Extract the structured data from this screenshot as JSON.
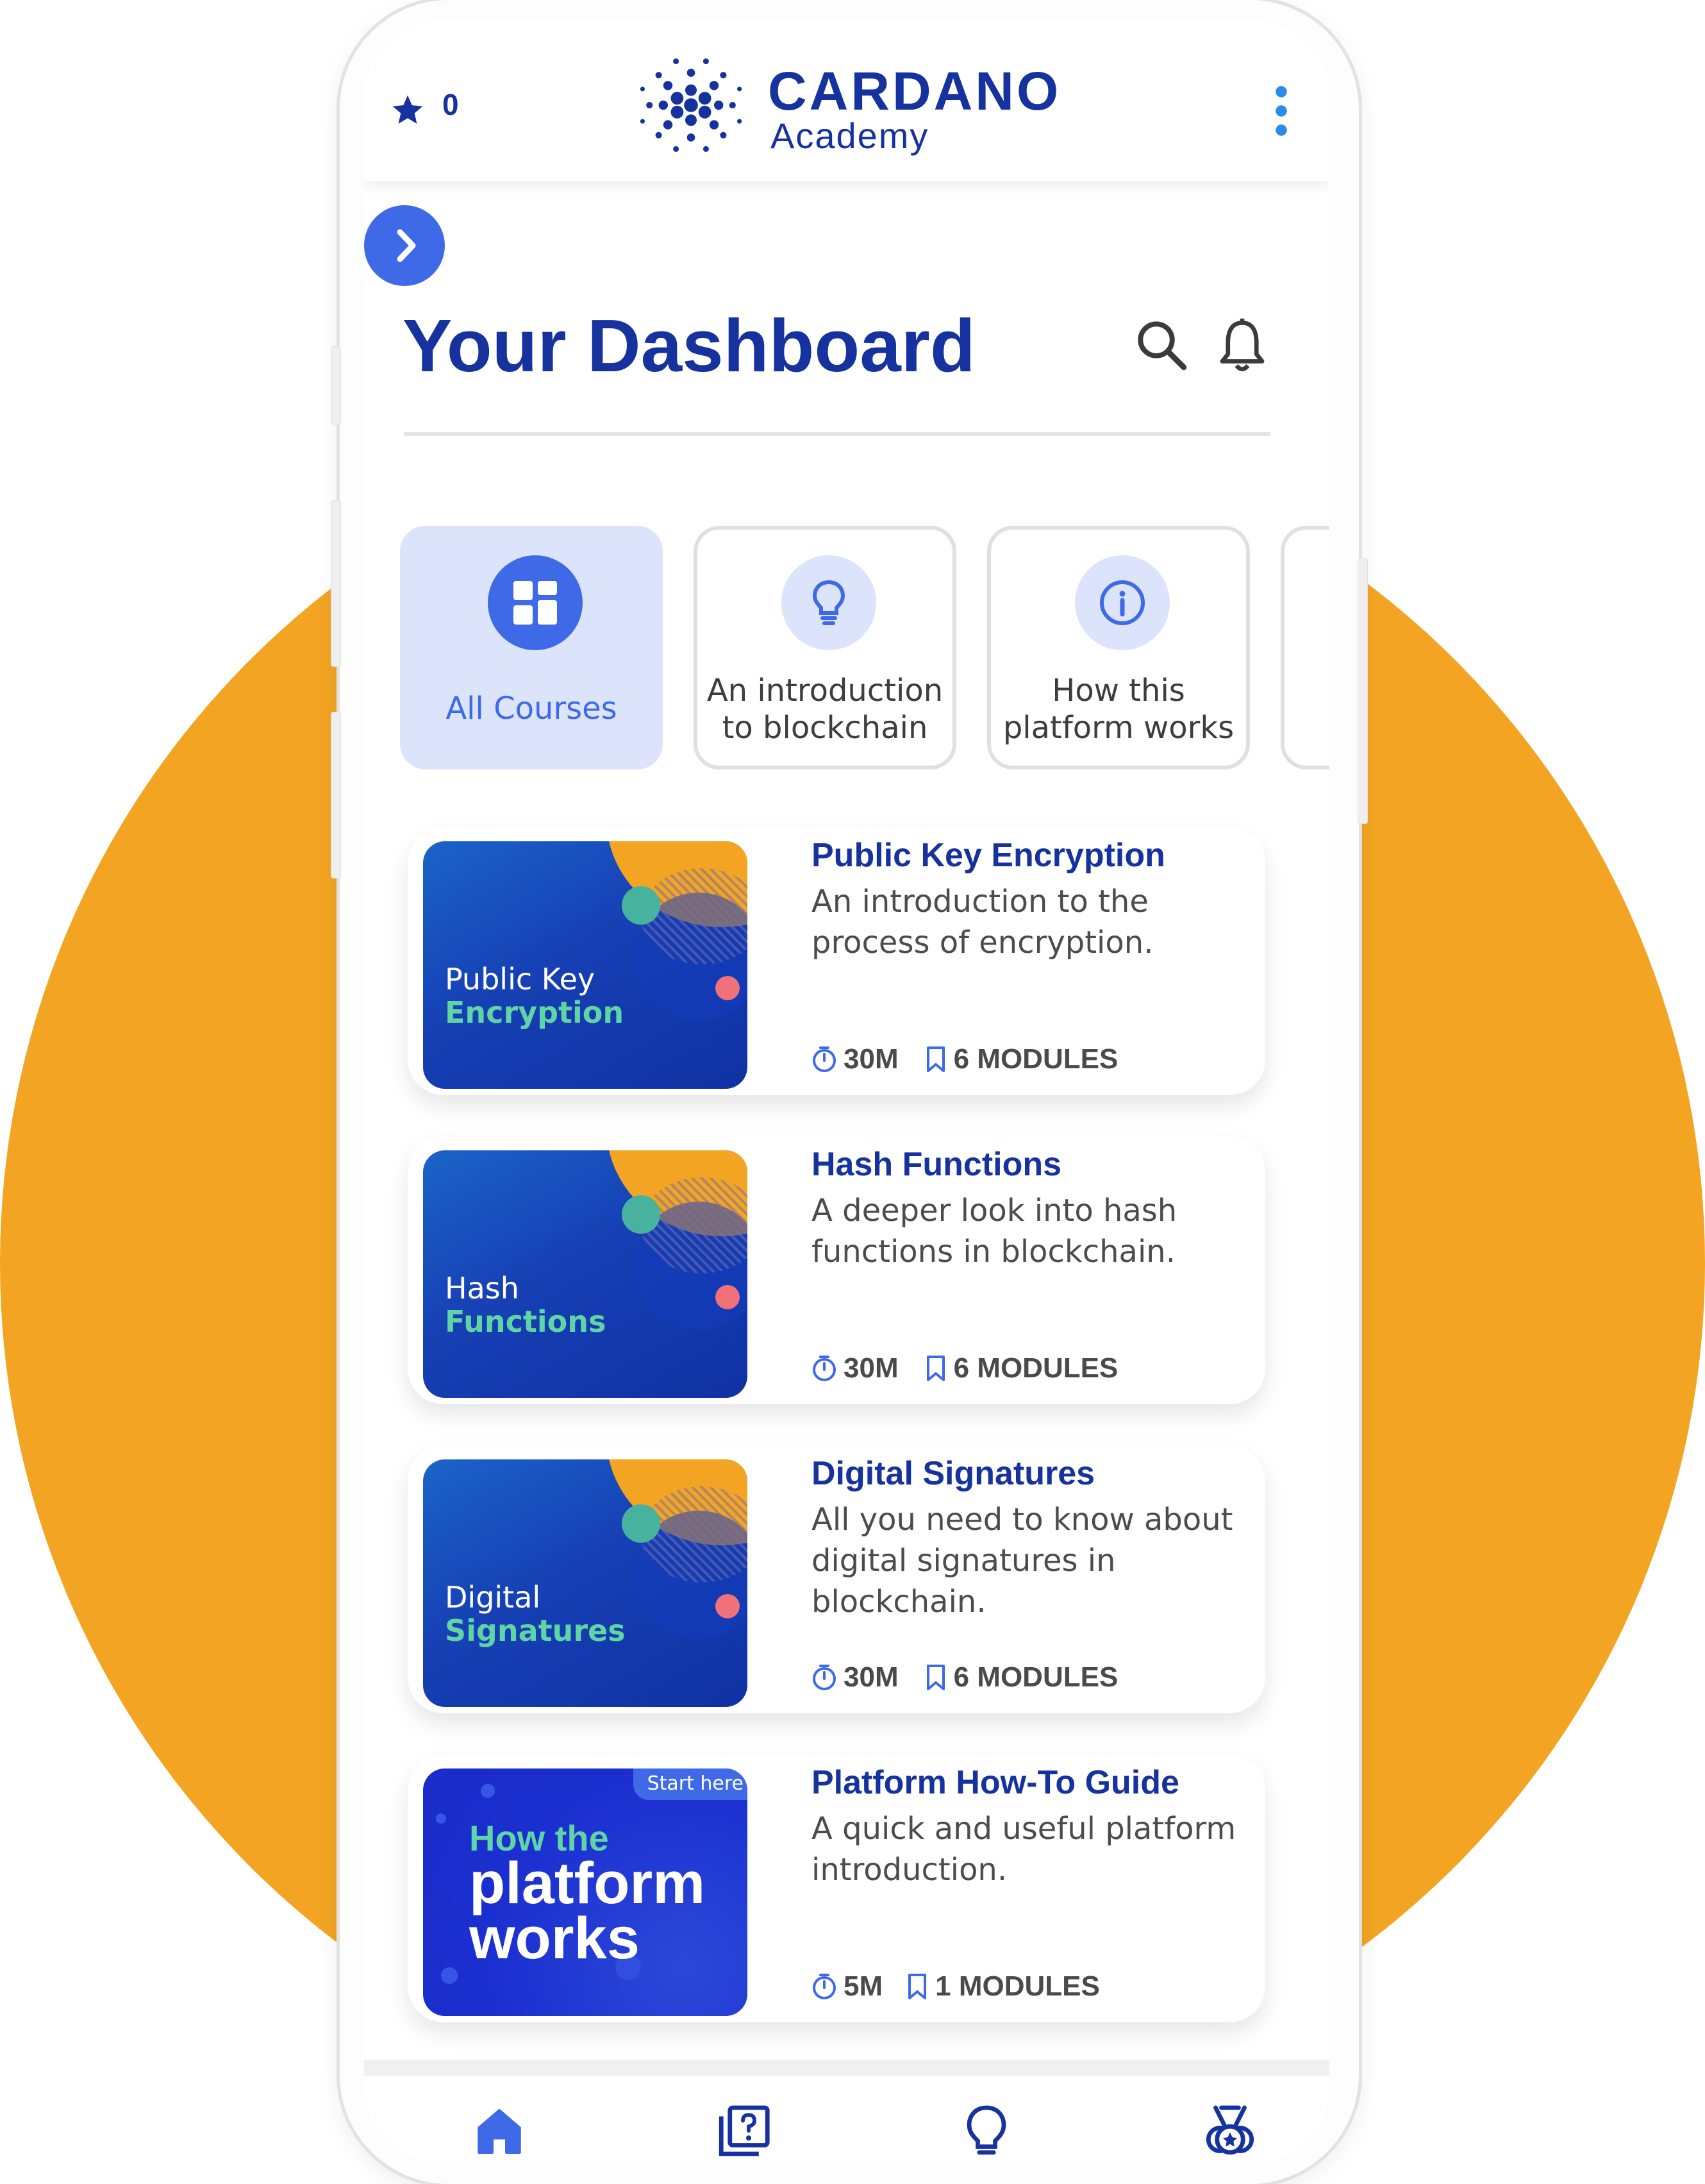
{
  "header": {
    "star_count": "0",
    "brand_name": "CARDANO",
    "brand_sub": "Academy"
  },
  "page": {
    "title": "Your Dashboard"
  },
  "tabs": [
    {
      "label": "All Courses",
      "icon": "grid-icon",
      "active": true
    },
    {
      "label": "An introduction to blockchain",
      "icon": "lightbulb-icon",
      "active": false
    },
    {
      "label": "How this platform works",
      "icon": "info-icon",
      "active": false
    }
  ],
  "courses": [
    {
      "title": "Public Key Encryption",
      "description": "An introduction to the process of encryption.",
      "thumb_line1": "Public Key",
      "thumb_line2": "Encryption",
      "duration": "30M",
      "modules": "6 MODULES"
    },
    {
      "title": "Hash Functions",
      "description": "A deeper look into hash functions in blockchain.",
      "thumb_line1": "Hash",
      "thumb_line2": "Functions",
      "duration": "30M",
      "modules": "6 MODULES"
    },
    {
      "title": "Digital Signatures",
      "description": "All you need to know about digital signatures in blockchain.",
      "thumb_line1": "Digital",
      "thumb_line2": "Signatures",
      "duration": "30M",
      "modules": "6 MODULES"
    },
    {
      "title": "Platform How-To Guide",
      "description": "A quick and useful platform introduction.",
      "thumb_badge": "Start here",
      "thumb_line1": "How the",
      "thumb_line2": "platform works",
      "duration": "5M",
      "modules": "1 MODULES"
    }
  ],
  "nav": [
    {
      "icon": "home-icon",
      "active": true
    },
    {
      "icon": "quiz-icon",
      "active": false
    },
    {
      "icon": "lightbulb-icon",
      "active": false
    },
    {
      "icon": "medal-icon",
      "active": false
    }
  ],
  "colors": {
    "brand": "#16329e",
    "accent": "#3F6AE7",
    "background_circle": "#F2A422",
    "active_tab_bg": "#dbe4fb"
  }
}
